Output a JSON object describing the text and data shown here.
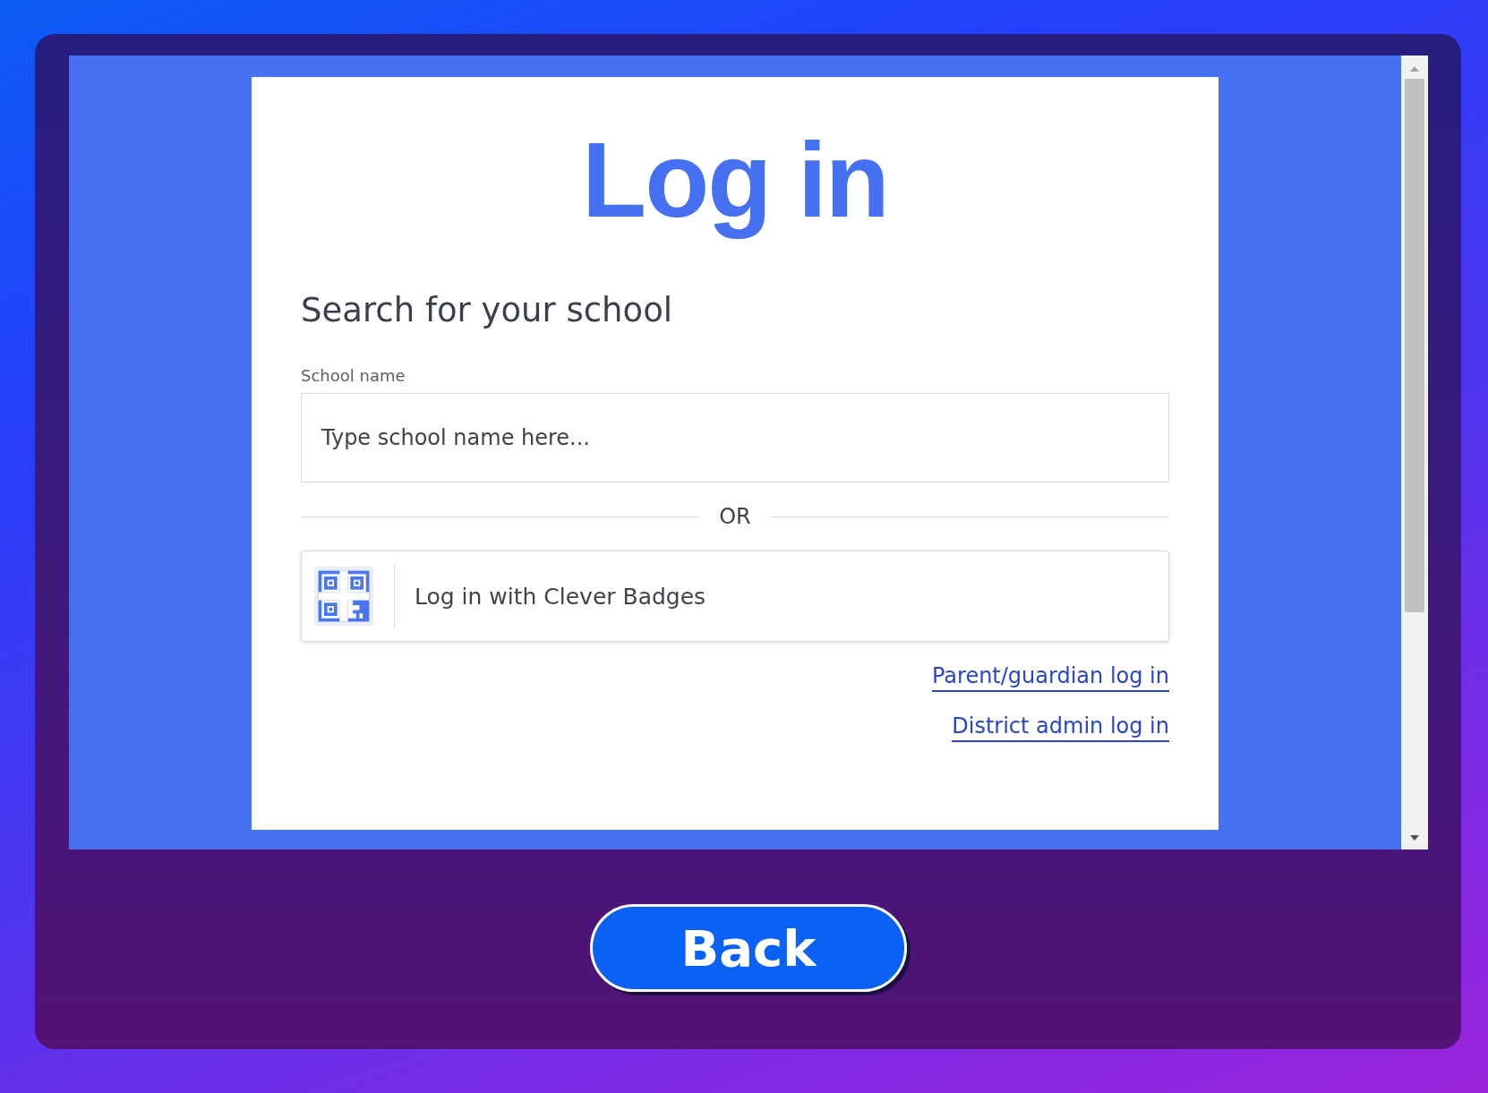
{
  "title": "Log in",
  "heading": "Search for your school",
  "school_field": {
    "label": "School name",
    "placeholder": "Type school name here..."
  },
  "divider": "OR",
  "badge_button": {
    "label": "Log in with Clever Badges"
  },
  "links": [
    {
      "label": "Parent/guardian log in"
    },
    {
      "label": "District admin log in"
    }
  ],
  "back_button": {
    "label": "Back"
  }
}
